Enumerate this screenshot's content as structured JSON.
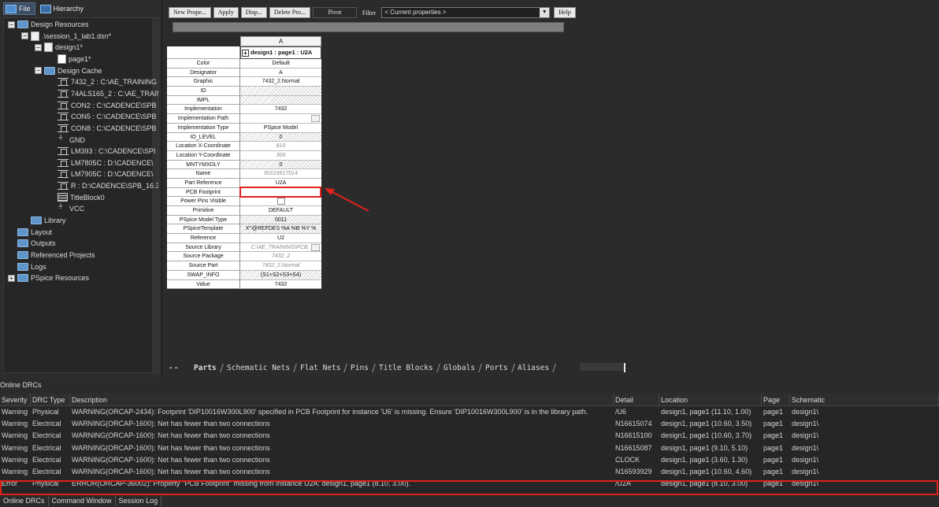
{
  "left_tabs": [
    {
      "label": "File",
      "active": true
    },
    {
      "label": "Hierarchy",
      "active": false
    }
  ],
  "tree": [
    {
      "label": "Design Resources",
      "depth": 0,
      "icon": "folder-icon",
      "exp": "-"
    },
    {
      "label": ".\\session_1_lab1.dsn*",
      "depth": 1,
      "icon": "design-file-icon",
      "exp": "-"
    },
    {
      "label": "design1*",
      "depth": 2,
      "icon": "schematic-folder-icon",
      "exp": "-"
    },
    {
      "label": "page1*",
      "depth": 3,
      "icon": "page-icon",
      "exp": ""
    },
    {
      "label": "Design Cache",
      "depth": 2,
      "icon": "folder-icon",
      "exp": "-"
    },
    {
      "label": "7432_2 : C:\\AE_TRAINING",
      "depth": 3,
      "icon": "part-icon",
      "exp": ""
    },
    {
      "label": "74ALS165_2 : C:\\AE_TRAIN",
      "depth": 3,
      "icon": "part-icon",
      "exp": ""
    },
    {
      "label": "CON2 : C:\\CADENCE\\SPB",
      "depth": 3,
      "icon": "part-icon",
      "exp": ""
    },
    {
      "label": "CON5 : C:\\CADENCE\\SPB",
      "depth": 3,
      "icon": "part-icon",
      "exp": ""
    },
    {
      "label": "CON8 : C:\\CADENCE\\SPB",
      "depth": 3,
      "icon": "part-icon",
      "exp": ""
    },
    {
      "label": "GND",
      "depth": 3,
      "icon": "gnd-icon",
      "exp": ""
    },
    {
      "label": "LM393 : C:\\CADENCE\\SPI",
      "depth": 3,
      "icon": "part-icon",
      "exp": ""
    },
    {
      "label": "LM7805C : D:\\CADENCE\\",
      "depth": 3,
      "icon": "part-icon",
      "exp": ""
    },
    {
      "label": "LM7905C : D:\\CADENCE\\",
      "depth": 3,
      "icon": "part-icon",
      "exp": ""
    },
    {
      "label": "R : D:\\CADENCE\\SPB_16.3",
      "depth": 3,
      "icon": "part-icon",
      "exp": ""
    },
    {
      "label": "TitleBlock0",
      "depth": 3,
      "icon": "titleblock-icon",
      "exp": ""
    },
    {
      "label": "VCC",
      "depth": 3,
      "icon": "gnd-icon",
      "exp": ""
    },
    {
      "label": "Library",
      "depth": 1,
      "icon": "folder-icon",
      "exp": ""
    },
    {
      "label": "Layout",
      "depth": 0,
      "icon": "folder-icon",
      "exp": ""
    },
    {
      "label": "Outputs",
      "depth": 0,
      "icon": "folder-icon",
      "exp": ""
    },
    {
      "label": "Referenced Projects",
      "depth": 0,
      "icon": "folder-icon",
      "exp": ""
    },
    {
      "label": "Logs",
      "depth": 0,
      "icon": "folder-icon",
      "exp": ""
    },
    {
      "label": "PSpice Resources",
      "depth": 0,
      "icon": "folder-icon",
      "exp": "+"
    }
  ],
  "toolbar": {
    "new_property": "New Prope...",
    "apply": "Apply",
    "display": "Disp...",
    "delete_property": "Delete Pro...",
    "pivot": "Pivot",
    "filter_label": "Filter",
    "filter_value": "< Current properties >",
    "help": "Help"
  },
  "grid": {
    "column_letter": "A",
    "instance": "design1 : page1 : U2A",
    "rows": [
      {
        "name": "Color",
        "value": "Default",
        "style": ""
      },
      {
        "name": "Designator",
        "value": "A",
        "style": ""
      },
      {
        "name": "Graphic",
        "value": "7432_2.Normal",
        "style": ""
      },
      {
        "name": "ID",
        "value": "",
        "style": "hatch"
      },
      {
        "name": "IMPL",
        "value": "",
        "style": "hatch"
      },
      {
        "name": "Implementation",
        "value": "7432",
        "style": ""
      },
      {
        "name": "Implementation Path",
        "value": "",
        "style": "chk"
      },
      {
        "name": "Implementation Type",
        "value": "PSpice Model",
        "style": ""
      },
      {
        "name": "IO_LEVEL",
        "value": "0",
        "style": "hatch"
      },
      {
        "name": "Location X-Coordinate",
        "value": "810",
        "style": "italic"
      },
      {
        "name": "Location Y-Coordinate",
        "value": "300",
        "style": "italic"
      },
      {
        "name": "MNTYMXDLY",
        "value": "0",
        "style": "hatch"
      },
      {
        "name": "Name",
        "value": "INS16617014",
        "style": "italic"
      },
      {
        "name": "Part Reference",
        "value": "U2A",
        "style": ""
      },
      {
        "name": "PCB Footprint",
        "value": "",
        "style": ""
      },
      {
        "name": "Power Pins Visible",
        "value": "",
        "style": "chkc"
      },
      {
        "name": "Primitive",
        "value": "DEFAULT",
        "style": ""
      },
      {
        "name": "PSpice Model Type",
        "value": "0011",
        "style": "hatch"
      },
      {
        "name": "PSpiceTemplate",
        "value": "X^@REFDES %A %B %Y %",
        "style": "hatch"
      },
      {
        "name": "Reference",
        "value": "U2",
        "style": ""
      },
      {
        "name": "Source Library",
        "value": "C:\\AE_TRAINING\\PCB_",
        "style": "italic chk"
      },
      {
        "name": "Source Package",
        "value": "7432_2",
        "style": "italic"
      },
      {
        "name": "Source Part",
        "value": "7432_2.Normal",
        "style": "italic"
      },
      {
        "name": "SWAP_INFO",
        "value": "(S1+S2+S3+S4)",
        "style": "hatch"
      },
      {
        "name": "Value",
        "value": "7432",
        "style": ""
      }
    ]
  },
  "sheet_tabs": [
    "Parts",
    "Schematic Nets",
    "Flat Nets",
    "Pins",
    "Title Blocks",
    "Globals",
    "Ports",
    "Aliases"
  ],
  "drc": {
    "title": "Online DRCs",
    "headers": [
      "Severity",
      "DRC Type",
      "Description",
      "Detail",
      "Location",
      "Page",
      "Schematic"
    ],
    "rows": [
      [
        "Warning",
        "Physical",
        "WARNING(ORCAP-2434): Footprint 'DIP10016W300L900' specified in PCB Footprint for instance 'U6' is missing. Ensure 'DIP10016W300L900' is in the library path.",
        "/U6",
        "design1, page1  (11.10, 1.00)",
        "page1",
        "design1\\"
      ],
      [
        "Warning",
        "Electrical",
        "WARNING(ORCAP-1600): Net has fewer than two connections",
        "N16615074",
        "design1, page1  (10.60, 3.50)",
        "page1",
        "design1\\"
      ],
      [
        "Warning",
        "Electrical",
        "WARNING(ORCAP-1600): Net has fewer than two connections",
        "N16615100",
        "design1, page1  (10.60, 3.70)",
        "page1",
        "design1\\"
      ],
      [
        "Warning",
        "Electrical",
        "WARNING(ORCAP-1600): Net has fewer than two connections",
        "N16615087",
        "design1, page1  (9.10, 5.10)",
        "page1",
        "design1\\"
      ],
      [
        "Warning",
        "Electrical",
        "WARNING(ORCAP-1600): Net has fewer than two connections",
        "CLOCK",
        "design1, page1  (3.60, 1.30)",
        "page1",
        "design1\\"
      ],
      [
        "Warning",
        "Electrical",
        "WARNING(ORCAP-1600): Net has fewer than two connections",
        "N16593929",
        "design1, page1  (10.60, 4.60)",
        "page1",
        "design1\\"
      ],
      [
        "Error",
        "Physical",
        "ERROR(ORCAP-36002): Property \"PCB Footprint\" missing from instance U2A: design1, page1 (8.10, 3.00).",
        "/U2A",
        "design1, page1  (8.10, 3.00)",
        "page1",
        "design1\\"
      ]
    ]
  },
  "bottom_tabs": [
    "Online DRCs",
    "Command Window",
    "Session Log"
  ],
  "colors": {
    "highlight": "#e0211c",
    "background": "#2b2b2b"
  }
}
